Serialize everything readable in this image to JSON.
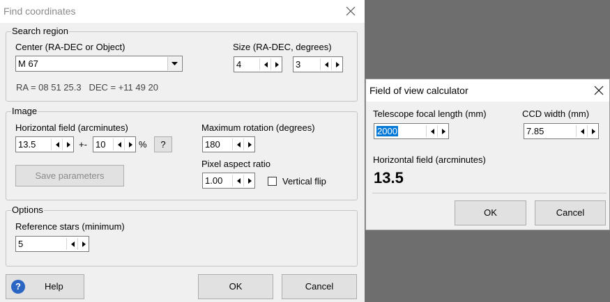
{
  "main_dialog": {
    "title": "Find coordinates",
    "search_region": {
      "legend": "Search region",
      "center_label": "Center (RA-DEC or Object)",
      "center_value": "M 67",
      "size_label": "Size (RA-DEC, degrees)",
      "size_ra": "4",
      "size_dec": "3",
      "coords_text": "RA = 08 51 25.3   DEC = +11 49 20"
    },
    "image": {
      "legend": "Image",
      "hfield_label": "Horizontal field (arcminutes)",
      "hfield_value": "13.5",
      "plusminus": "+-",
      "tolerance_value": "10",
      "percent": "%",
      "question_button": "?",
      "save_button": "Save parameters",
      "rotation_label": "Maximum rotation (degrees)",
      "rotation_value": "180",
      "aspect_label": "Pixel aspect ratio",
      "aspect_value": "1.00",
      "vflip_label": "Vertical flip"
    },
    "options": {
      "legend": "Options",
      "ref_label": "Reference stars (minimum)",
      "ref_value": "5"
    },
    "buttons": {
      "help": "Help",
      "ok": "OK",
      "cancel": "Cancel"
    }
  },
  "fov_dialog": {
    "title": "Field of view calculator",
    "focal_label": "Telescope focal length (mm)",
    "focal_value": "2000",
    "ccd_label": "CCD width (mm)",
    "ccd_value": "7.85",
    "hfield_label": "Horizontal field (arcminutes)",
    "hfield_value": "13.5",
    "ok": "OK",
    "cancel": "Cancel"
  },
  "icons": {
    "close": "close-icon",
    "spin_left": "spin-left-icon",
    "spin_right": "spin-right-icon",
    "dropdown": "chevron-down-icon",
    "help": "help-icon"
  }
}
